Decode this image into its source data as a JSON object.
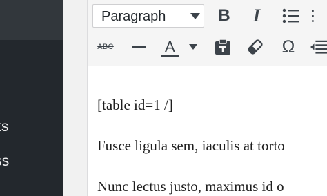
{
  "sidebar": {
    "items": [
      {
        "label": "ts"
      },
      {
        "label": "ss"
      }
    ]
  },
  "toolbar": {
    "format_select": {
      "value": "Paragraph"
    },
    "row1": [
      {
        "icon": "bold-icon",
        "glyph": "B"
      },
      {
        "icon": "italic-icon",
        "glyph": "I"
      },
      {
        "icon": "bulleted-list-icon"
      }
    ],
    "row2": [
      {
        "icon": "strikethrough-icon",
        "glyph": "ABC"
      },
      {
        "icon": "horizontal-line-icon"
      },
      {
        "icon": "text-color-icon",
        "glyph": "A",
        "color": "#3c434a"
      },
      {
        "icon": "paste-as-text-icon"
      },
      {
        "icon": "clear-formatting-icon"
      },
      {
        "icon": "special-character-icon",
        "glyph": "Ω"
      },
      {
        "icon": "outdent-icon"
      }
    ]
  },
  "content": {
    "paragraphs": [
      "[table id=1 /]",
      "Fusce ligula sem, iaculis at torto",
      "Nunc lectus justo, maximus id o"
    ]
  }
}
